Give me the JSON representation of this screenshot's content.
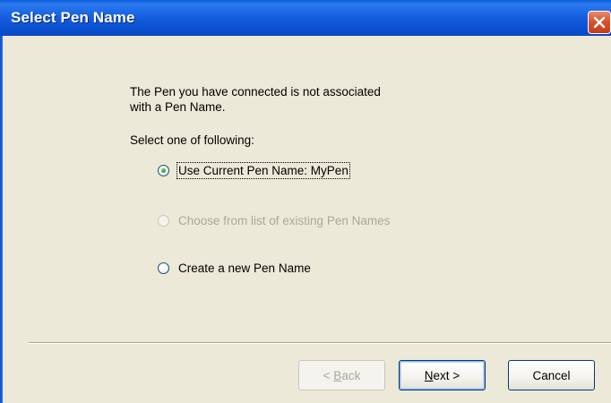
{
  "window": {
    "title": "Select Pen Name"
  },
  "content": {
    "message_line1": "The Pen you have connected is not associated",
    "message_line2": "with a Pen Name.",
    "select_prompt": "Select one of following:",
    "options": [
      {
        "label": "Use Current Pen Name:  MyPen",
        "checked": true,
        "enabled": true
      },
      {
        "label": "Choose from list of existing Pen Names",
        "checked": false,
        "enabled": false
      },
      {
        "label": "Create a new Pen Name",
        "checked": false,
        "enabled": true
      }
    ]
  },
  "buttons": {
    "back_prefix": "< ",
    "back_mnemonic": "B",
    "back_rest": "ack",
    "next_mnemonic": "N",
    "next_rest": "ext >",
    "cancel": "Cancel"
  },
  "icons": {
    "close": "close-icon"
  },
  "colors": {
    "titlebar": "#0a5fd8",
    "close_button": "#d8552e",
    "dialog_background": "#ece9d8",
    "disabled_text": "#aca899"
  }
}
